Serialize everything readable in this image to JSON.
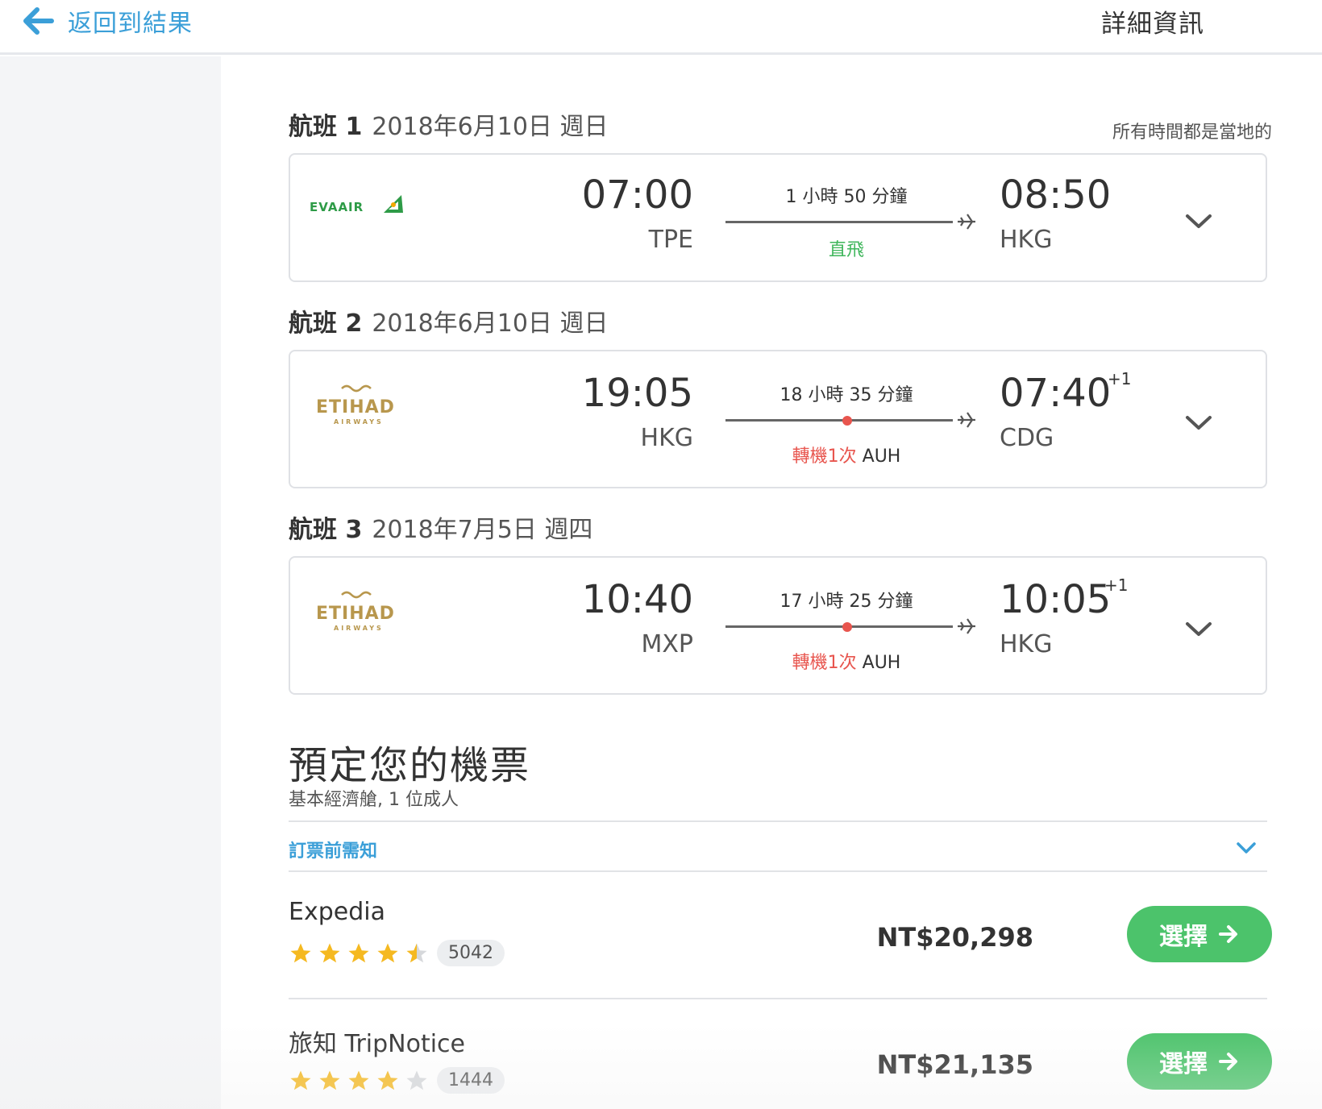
{
  "header": {
    "back_label": "返回到結果",
    "title": "詳細資訊"
  },
  "local_time_note": "所有時間都是當地的",
  "legs": [
    {
      "label": "航班 1",
      "date": "2018年6月10日 週日",
      "airline": "EVA AIR",
      "dep_time": "07:00",
      "dep_code": "TPE",
      "arr_time": "08:50",
      "arr_code": "HKG",
      "arr_plus": "",
      "duration": "1 小時 50 分鐘",
      "stop_label": "直飛",
      "stop_code": ""
    },
    {
      "label": "航班 2",
      "date": "2018年6月10日 週日",
      "airline": "ETIHAD AIRWAYS",
      "dep_time": "19:05",
      "dep_code": "HKG",
      "arr_time": "07:40",
      "arr_code": "CDG",
      "arr_plus": "+1",
      "duration": "18 小時 35 分鐘",
      "stop_label": "轉機1次",
      "stop_code": "AUH"
    },
    {
      "label": "航班 3",
      "date": "2018年7月5日 週四",
      "airline": "ETIHAD AIRWAYS",
      "dep_time": "10:40",
      "dep_code": "MXP",
      "arr_time": "10:05",
      "arr_code": "HKG",
      "arr_plus": "+1",
      "duration": "17 小時 25 分鐘",
      "stop_label": "轉機1次",
      "stop_code": "AUH"
    }
  ],
  "booking": {
    "title": "預定您的機票",
    "subtitle": "基本經濟艙, 1 位成人",
    "notice_label": "訂票前需知",
    "providers": [
      {
        "name": "Expedia",
        "rating": 4.5,
        "reviews": "5042",
        "price": "NT$20,298",
        "button": "選擇"
      },
      {
        "name": "旅知 TripNotice",
        "rating": 4.0,
        "reviews": "1444",
        "price": "NT$21,135",
        "button": "選擇"
      }
    ]
  },
  "colors": {
    "link_blue": "#3b9fd8",
    "direct_green": "#3fb65b",
    "stop_red": "#e8554e",
    "button_green": "#4cc36b",
    "star_gold": "#f5b921",
    "eva_green": "#2e9b47",
    "etihad_gold": "#b8974d"
  },
  "icons": {
    "back": "arrow-left-icon",
    "plane": "plane-icon",
    "expand": "chevron-down-icon",
    "star": "star-icon",
    "button_arrow": "arrow-right-icon"
  }
}
